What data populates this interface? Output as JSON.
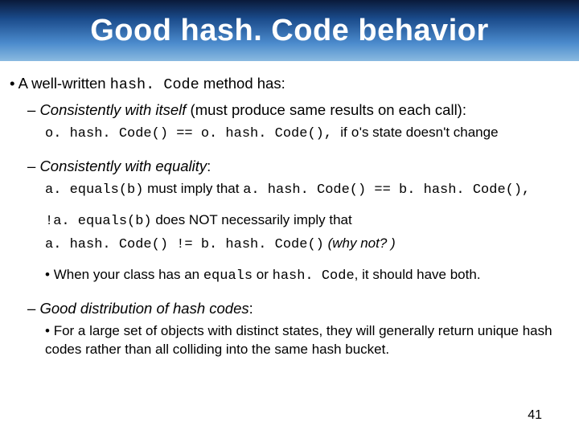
{
  "title": "Good hash. Code behavior",
  "l1": {
    "pre": "A well-written ",
    "code": "hash. Code",
    "post": " method has:"
  },
  "s1": {
    "head_i": "Consistently with itself",
    "head_post": "   (must produce same results on each call):",
    "det_code1": "o. hash. Code() == o. hash. Code(), ",
    "det_mid": "if ",
    "det_code2": "o",
    "det_post": "'s state doesn't change"
  },
  "s2": {
    "head_i": "Consistently with equality",
    "head_post": ":",
    "line1_c1": "a. equals(b)",
    "line1_mid": " must imply that ",
    "line1_c2": "a. hash. Code() == b. hash. Code(),",
    "line2_c1": "!a. equals(b)",
    "line2_mid": "  does NOT necessarily imply that",
    "line3_c1": "a. hash. Code() != b. hash. Code()",
    "line3_i": "   (why not? )",
    "both_pre": "When your class has an ",
    "both_c1": "equals",
    "both_mid": " or ",
    "both_c2": "hash. Code",
    "both_post": ", it should have both."
  },
  "s3": {
    "head_i": "Good distribution of hash codes",
    "head_post": ":",
    "detail": "For a large set of objects with distinct states, they will generally return unique hash codes rather than all colliding into the same hash bucket."
  },
  "slide_number": "41"
}
